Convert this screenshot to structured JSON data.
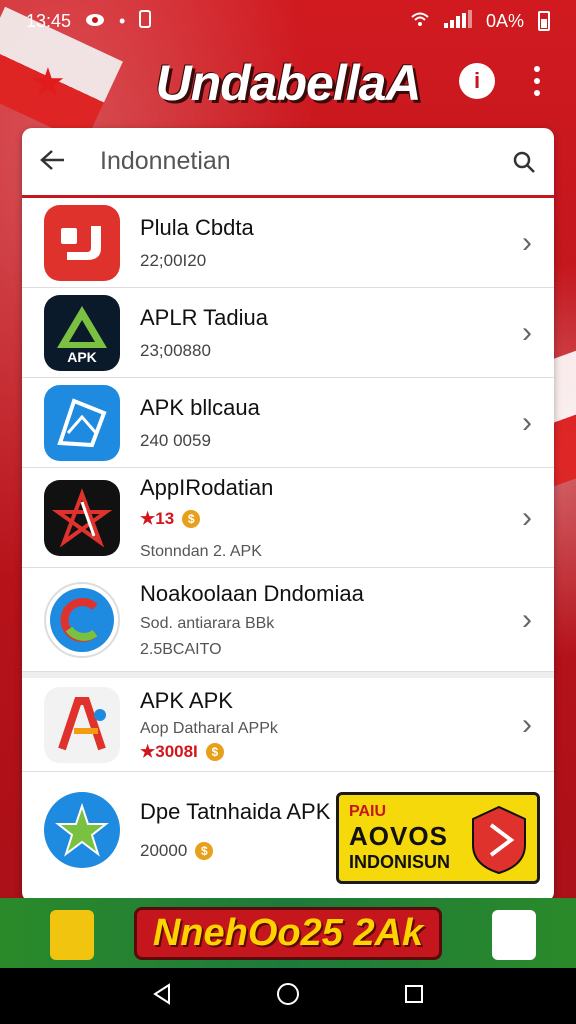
{
  "status_bar": {
    "time": "13:45",
    "battery_text": "0A%"
  },
  "app": {
    "title": "UndabellaA"
  },
  "search": {
    "value": "Indonnetian"
  },
  "items": [
    {
      "name": "Plula Cbdta",
      "line1": "22;00I20"
    },
    {
      "name": "APLR Tadiua",
      "line1": "23;00880"
    },
    {
      "name": "APK bllcaua",
      "line1": "240 0059"
    },
    {
      "name": "AppIRodatian",
      "rating": "★13",
      "line2": "Stonndan 2. APK"
    },
    {
      "name": "Noakoolaan Dndomiaa",
      "line1": "Sod. antiarara BBk",
      "line2": "2.5BCAITO"
    },
    {
      "name": "APK APK",
      "line1": "Aop DatharaI APPk",
      "rating": "★3008I"
    },
    {
      "name": "Dpe Tatnhaida APK",
      "line1": "20000"
    }
  ],
  "promo": {
    "top": "PAIU",
    "middle": "AOVOS",
    "bottom": "INDONISUN"
  },
  "banner": {
    "text": "NnehOo25 2Ak"
  },
  "colors": {
    "primary": "#c4161c",
    "banner_bg": "#1e7a3a",
    "promo_bg": "#f5d90a"
  }
}
